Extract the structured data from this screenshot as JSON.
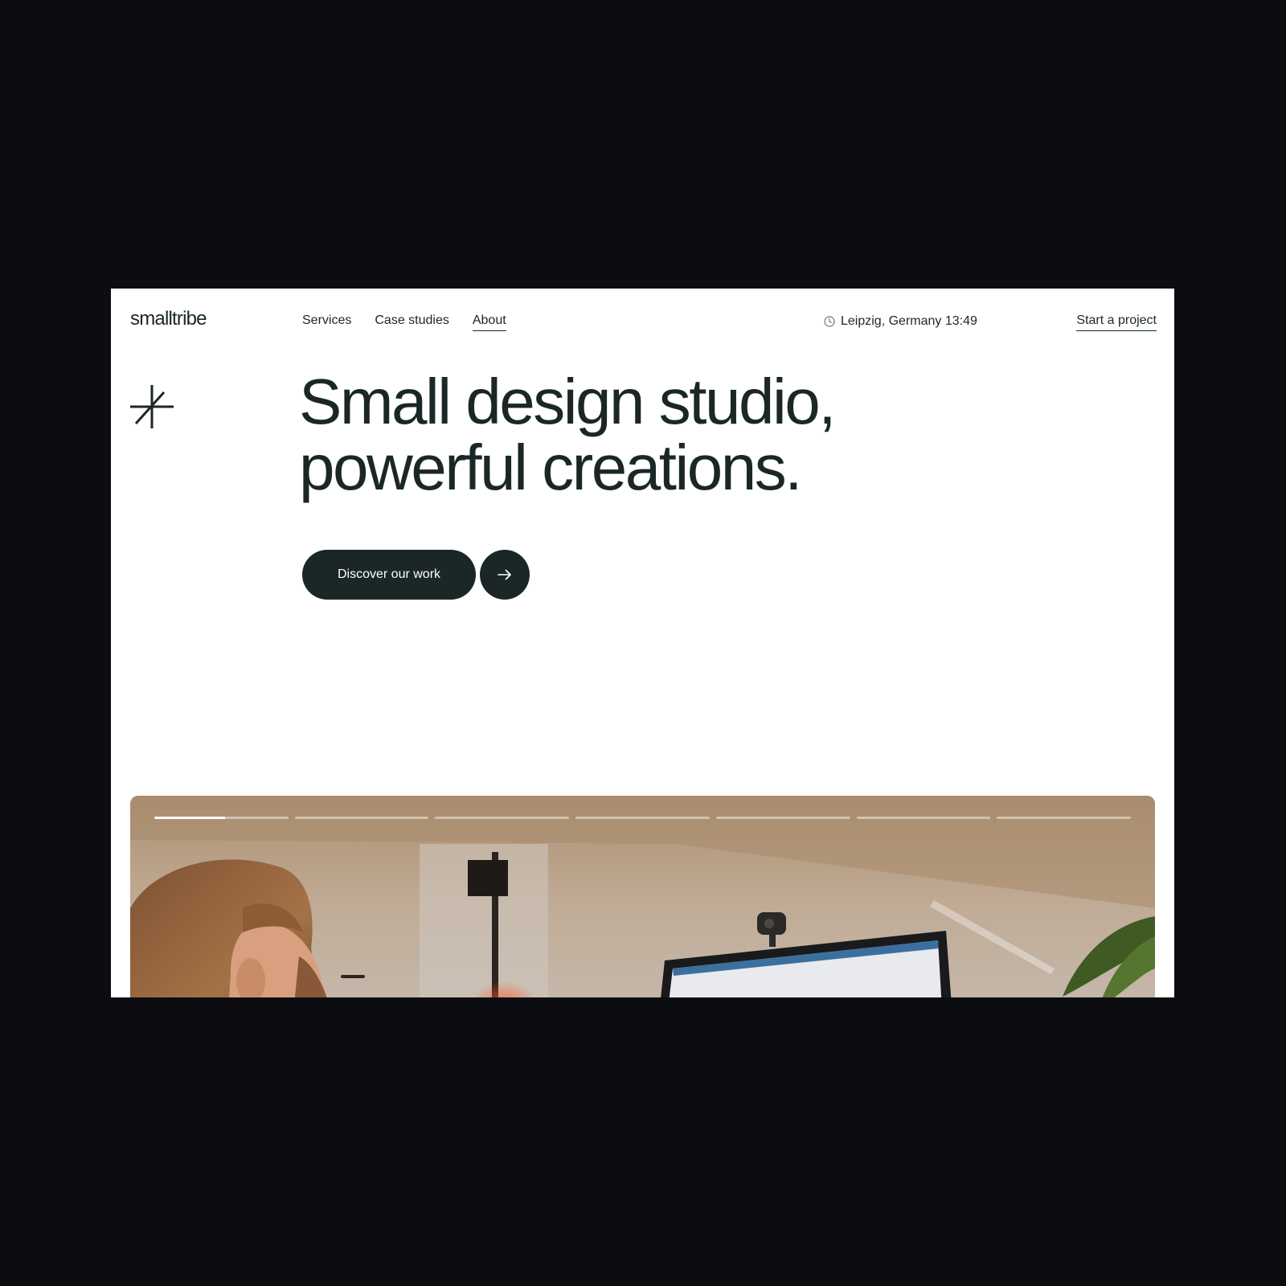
{
  "header": {
    "logo": "smalltribe",
    "nav": [
      {
        "label": "Services",
        "active": false
      },
      {
        "label": "Case studies",
        "active": false
      },
      {
        "label": "About",
        "active": true
      }
    ],
    "location": "Leipzig, Germany 13:49",
    "location_icon": "clock-icon",
    "cta": "Start a project"
  },
  "hero": {
    "mark_icon": "asterisk-mark-icon",
    "headline_line1": "Small design studio,",
    "headline_line2": "powerful creations.",
    "button_label": "Discover our work",
    "arrow_icon": "arrow-right-icon"
  },
  "slideshow": {
    "slides": 7,
    "current": 1,
    "current_progress": 0.53
  },
  "colors": {
    "background": "#0c0d10",
    "page": "#ffffff",
    "ink": "#1b2727"
  }
}
